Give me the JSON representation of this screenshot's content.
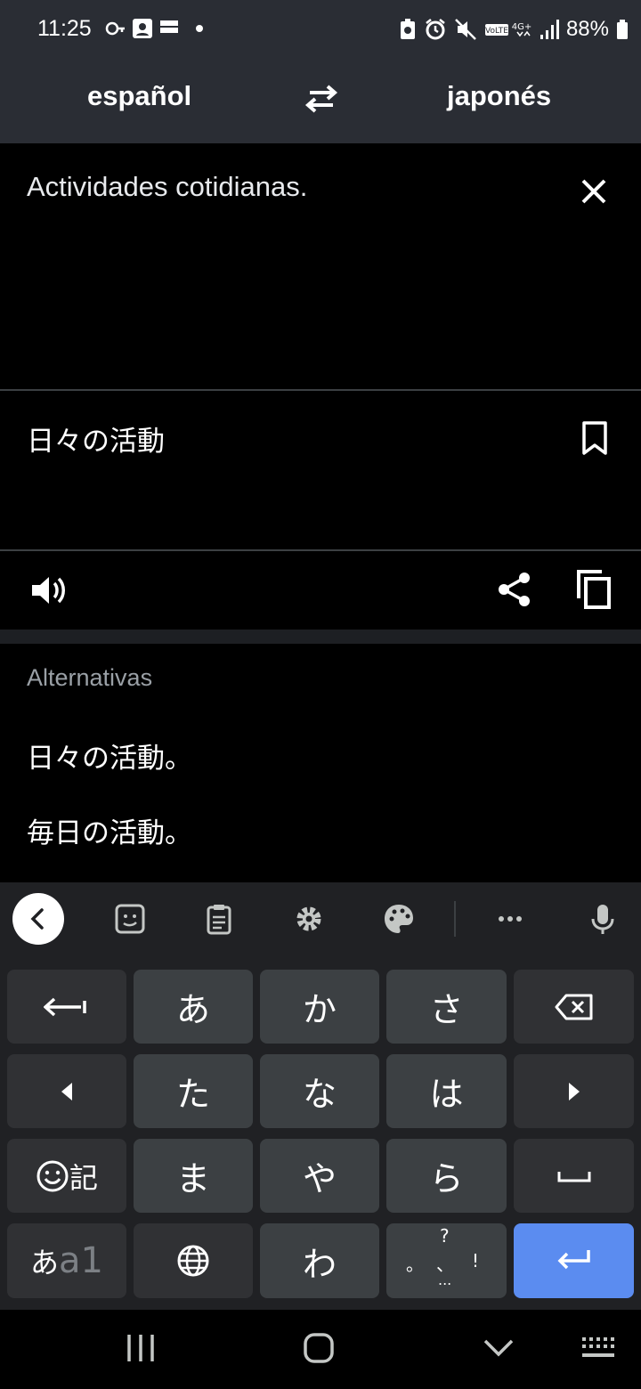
{
  "status": {
    "time": "11:25",
    "battery": "88%"
  },
  "header": {
    "source_language": "español",
    "target_language": "japonés"
  },
  "input": {
    "text": "Actividades cotidianas."
  },
  "translation": {
    "text": "日々の活動"
  },
  "alternatives": {
    "heading": "Alternativas",
    "items": [
      "日々の活動。",
      "毎日の活動。"
    ]
  },
  "keyboard": {
    "rows": [
      [
        "あ",
        "か",
        "さ"
      ],
      [
        "た",
        "な",
        "は"
      ],
      [
        "ま",
        "や",
        "ら"
      ],
      [
        "わ"
      ]
    ],
    "emoji_key_label": "記",
    "mode_key_kana": "あ",
    "mode_key_alnum": "a1",
    "punct_key": {
      "top": "?",
      "left": "。",
      "middle": "、",
      "right": "!",
      "bottom": "..."
    }
  },
  "colors": {
    "bar": "#2a2d34",
    "accent_enter": "#5b8cf0",
    "muted": "#9aa0a6"
  }
}
